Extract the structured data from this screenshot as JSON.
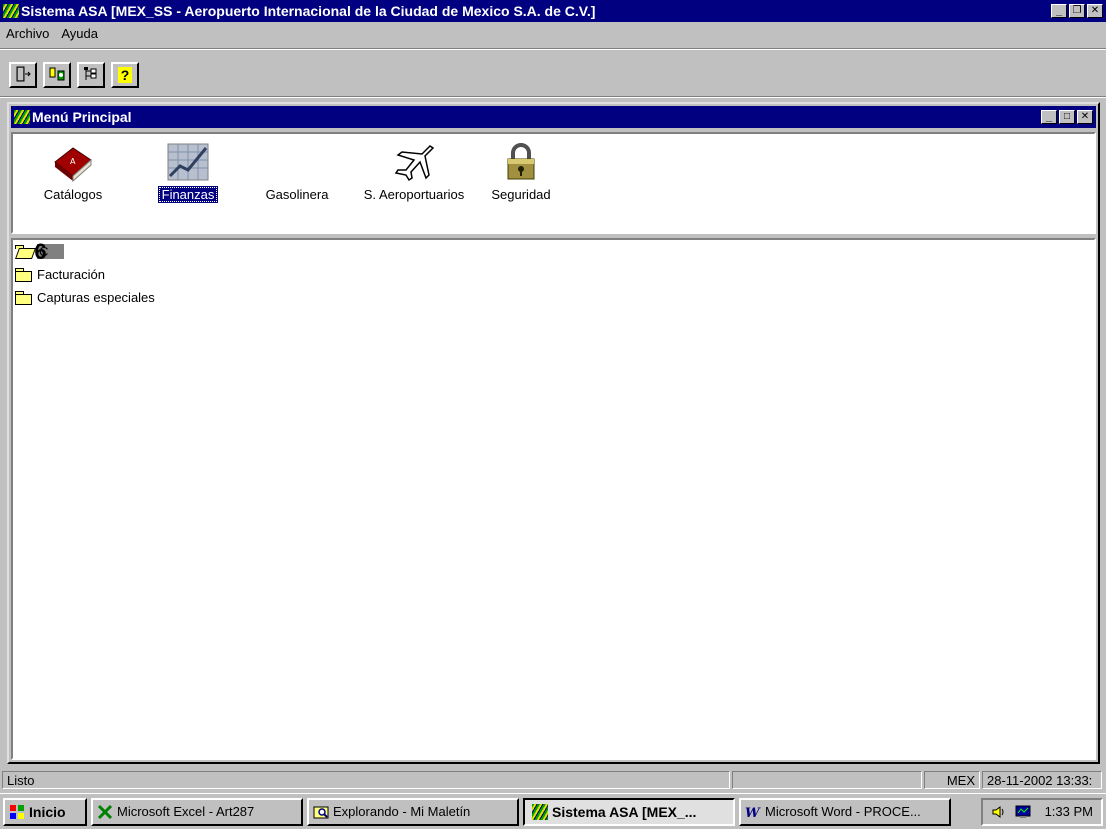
{
  "window": {
    "title": "Sistema ASA [MEX_SS - Aeropuerto Internacional de la Ciudad de Mexico S.A. de C.V.]",
    "controls": {
      "minimize": "_",
      "restore": "❐",
      "close": "✕"
    }
  },
  "menubar": [
    {
      "label": "Archivo"
    },
    {
      "label": "Ayuda"
    }
  ],
  "toolbar": [
    {
      "icon": "exit-door-icon",
      "glyph": "⇥"
    },
    {
      "icon": "connect-icon",
      "glyph": "⇆"
    },
    {
      "icon": "tree-icon",
      "glyph": "☷"
    },
    {
      "icon": "help-icon",
      "glyph": "?"
    }
  ],
  "mdi": {
    "title": "Menú Principal",
    "controls": {
      "minimize": "_",
      "maximize": "□",
      "close": "✕"
    }
  },
  "modules": [
    {
      "label": "Catálogos",
      "icon": "book-icon",
      "selected": false
    },
    {
      "label": "Finanzas",
      "icon": "finance-chart-icon",
      "selected": true
    },
    {
      "label": "Gasolinera",
      "icon": "",
      "selected": false
    },
    {
      "label": "S. Aeroportuarios",
      "icon": "airplane-icon",
      "selected": false
    },
    {
      "label": "Seguridad",
      "icon": "padlock-icon",
      "selected": false
    }
  ],
  "tree": [
    {
      "label": "C",
      "badge": "6",
      "open": true,
      "selected": true
    },
    {
      "label": "Facturación",
      "open": false,
      "selected": false
    },
    {
      "label": "Capturas especiales",
      "open": false,
      "selected": false
    }
  ],
  "statusbar": {
    "message": "Listo",
    "station": "MEX",
    "datetime": "28-11-2002 13:33:"
  },
  "taskbar": {
    "start": "Inicio",
    "tasks": [
      {
        "label": "Microsoft Excel - Art287",
        "icon": "excel-icon",
        "active": false
      },
      {
        "label": "Explorando - Mi Maletín",
        "icon": "explorer-icon",
        "active": false
      },
      {
        "label": "Sistema ASA [MEX_...",
        "icon": "asa-app-icon",
        "active": true
      },
      {
        "label": "Microsoft Word - PROCE...",
        "icon": "word-icon",
        "active": false
      }
    ],
    "clock": "1:33 PM"
  }
}
